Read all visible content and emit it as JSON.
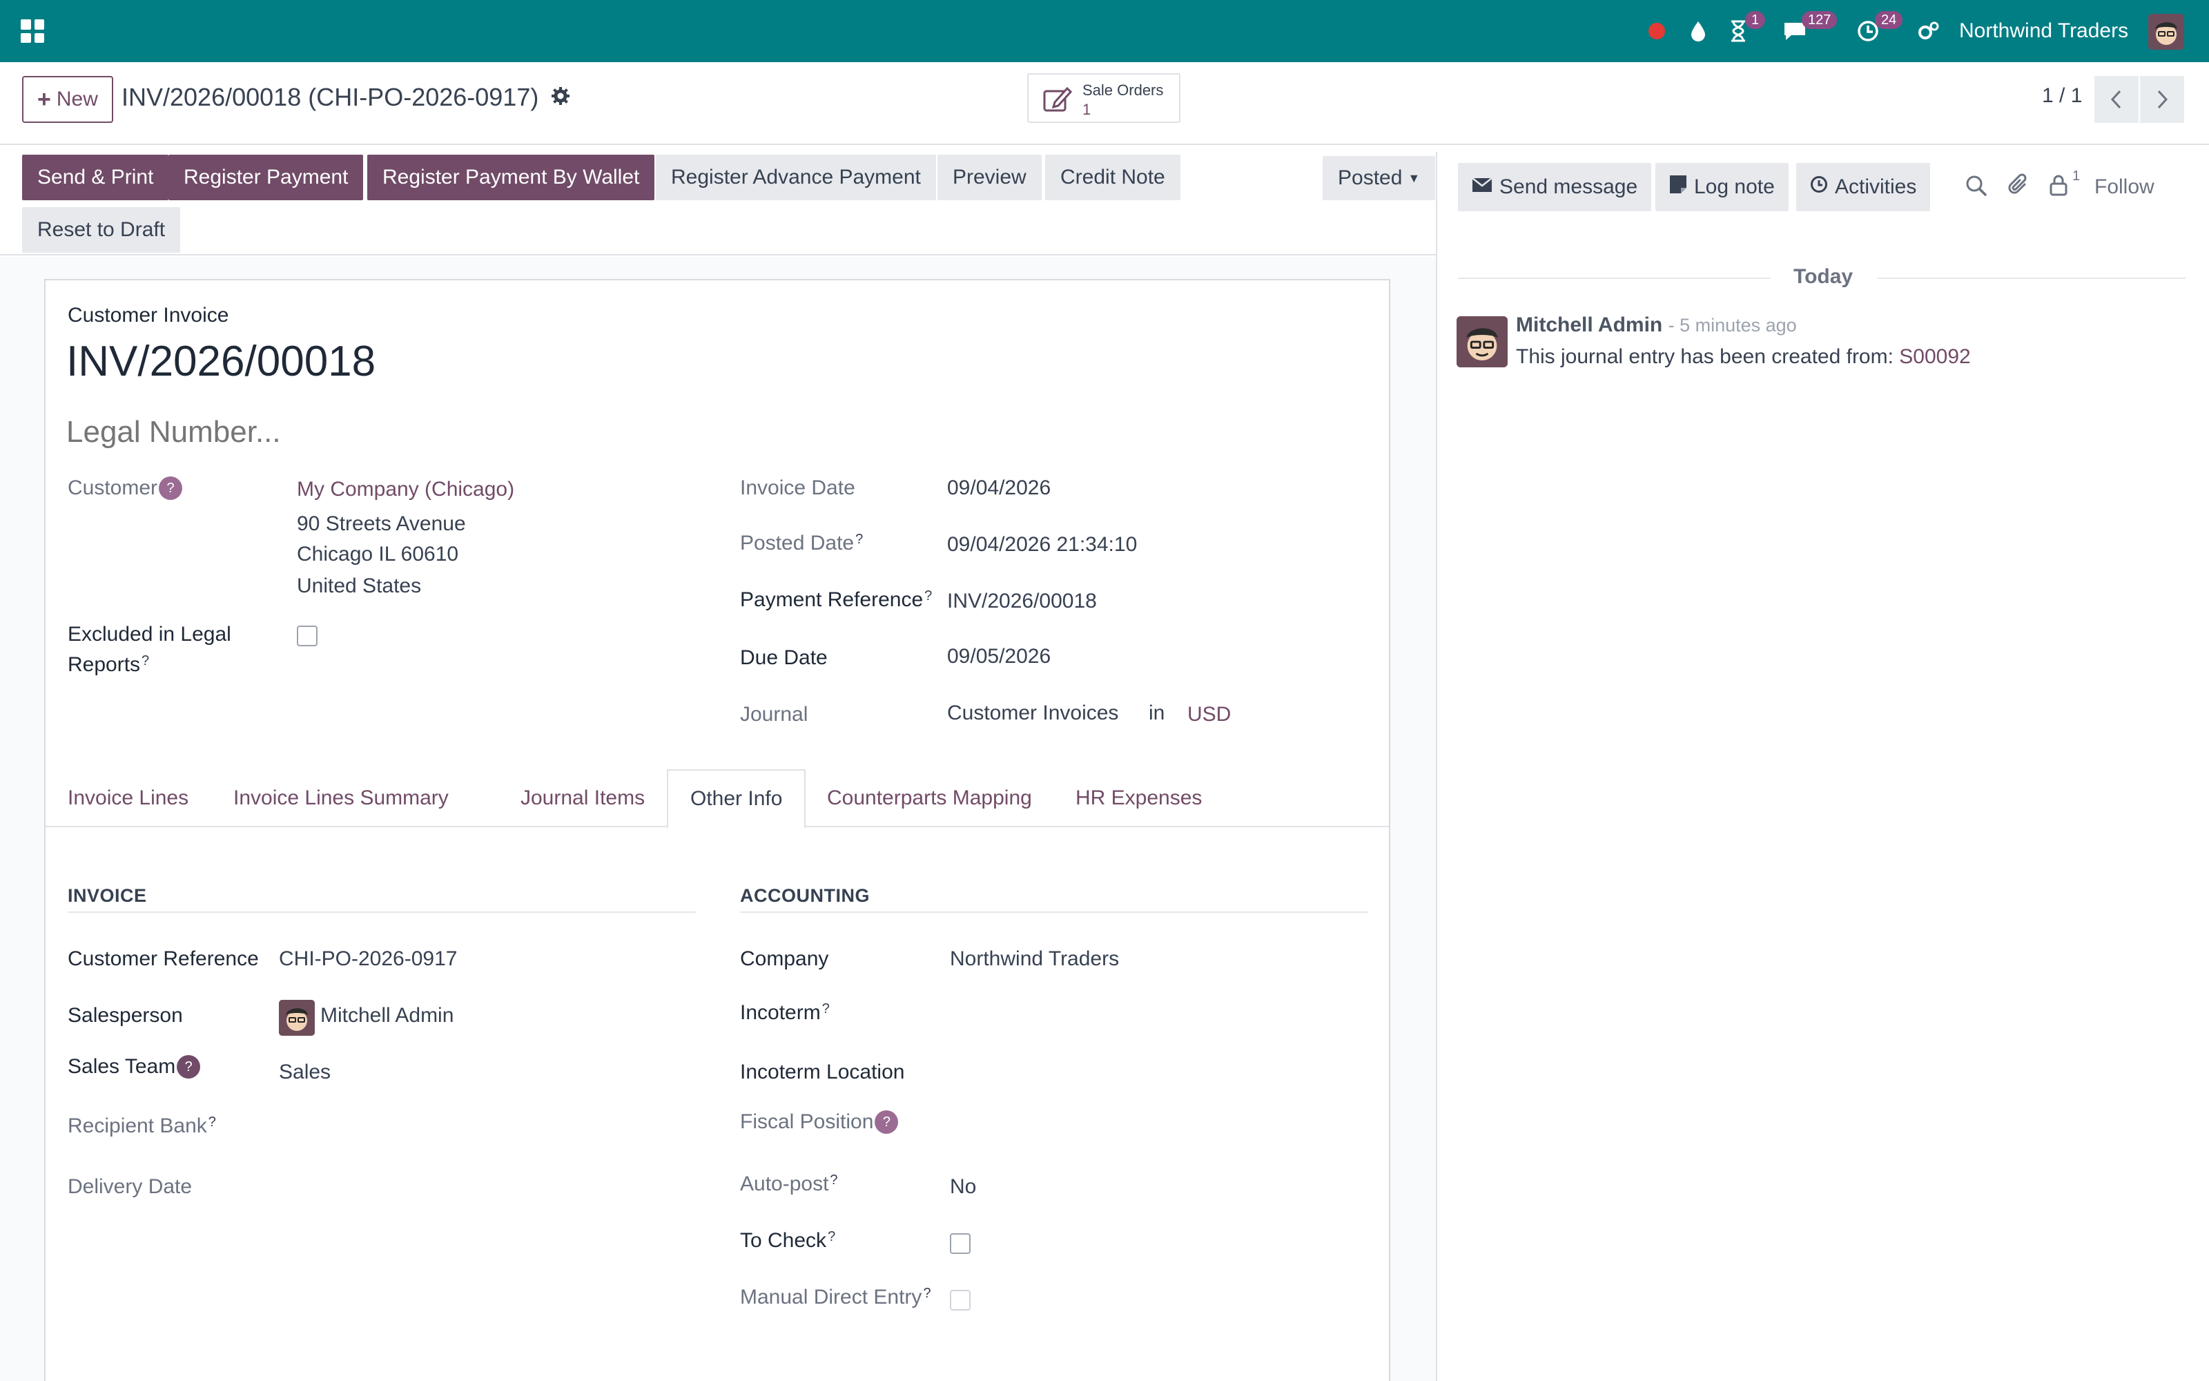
{
  "topbar": {
    "company": "Northwind Traders",
    "badges": {
      "activities": "1",
      "messages": "127",
      "timer": "24"
    }
  },
  "control_panel": {
    "new_label": "New",
    "breadcrumb": "INV/2026/00018 (CHI-PO-2026-0917)",
    "stat_button": {
      "label": "Sale Orders",
      "value": "1"
    },
    "pager": "1 / 1"
  },
  "actions": {
    "send_print": "Send & Print",
    "register_payment": "Register Payment",
    "register_payment_wallet": "Register Payment By Wallet",
    "register_advance_payment": "Register Advance Payment",
    "preview": "Preview",
    "credit_note": "Credit Note",
    "reset_draft": "Reset to Draft",
    "status": "Posted"
  },
  "form": {
    "move_type": "Customer Invoice",
    "name": "INV/2026/00018",
    "legal_number_placeholder": "Legal Number...",
    "customer_label": "Customer",
    "customer_name": "My Company (Chicago)",
    "address_line1": "90 Streets Avenue",
    "address_line2": "Chicago IL 60610",
    "address_line3": "United States",
    "excluded_label_1": "Excluded in Legal",
    "excluded_label_2": "Reports",
    "invoice_date_label": "Invoice Date",
    "invoice_date": "09/04/2026",
    "posted_date_label": "Posted Date",
    "posted_date": "09/04/2026 21:34:10",
    "payment_reference_label": "Payment Reference",
    "payment_reference": "INV/2026/00018",
    "due_date_label": "Due Date",
    "due_date": "09/05/2026",
    "journal_label": "Journal",
    "journal": "Customer Invoices",
    "journal_in": "in",
    "currency": "USD"
  },
  "tabs": [
    "Invoice Lines",
    "Invoice Lines Summary",
    "Journal Items",
    "Other Info",
    "Counterparts Mapping",
    "HR Expenses"
  ],
  "other_info": {
    "invoice_section": "INVOICE",
    "accounting_section": "ACCOUNTING",
    "customer_reference_label": "Customer Reference",
    "customer_reference": "CHI-PO-2026-0917",
    "salesperson_label": "Salesperson",
    "salesperson": "Mitchell Admin",
    "sales_team_label": "Sales Team",
    "sales_team": "Sales",
    "recipient_bank_label": "Recipient Bank",
    "delivery_date_label": "Delivery Date",
    "company_label": "Company",
    "company": "Northwind Traders",
    "incoterm_label": "Incoterm",
    "incoterm_location_label": "Incoterm Location",
    "fiscal_position_label": "Fiscal Position",
    "auto_post_label": "Auto-post",
    "auto_post": "No",
    "to_check_label": "To Check",
    "manual_direct_entry_label": "Manual Direct Entry"
  },
  "chatter": {
    "send_message": "Send message",
    "log_note": "Log note",
    "activities": "Activities",
    "followers_count": "1",
    "follow": "Follow",
    "today": "Today",
    "message": {
      "author": "Mitchell Admin",
      "time": "- 5 minutes ago",
      "body": "This journal entry has been created from:",
      "link": "S00092"
    }
  },
  "colors": {
    "brand": "#017e84",
    "primary": "#714b67",
    "badge": "#8e4b84"
  }
}
